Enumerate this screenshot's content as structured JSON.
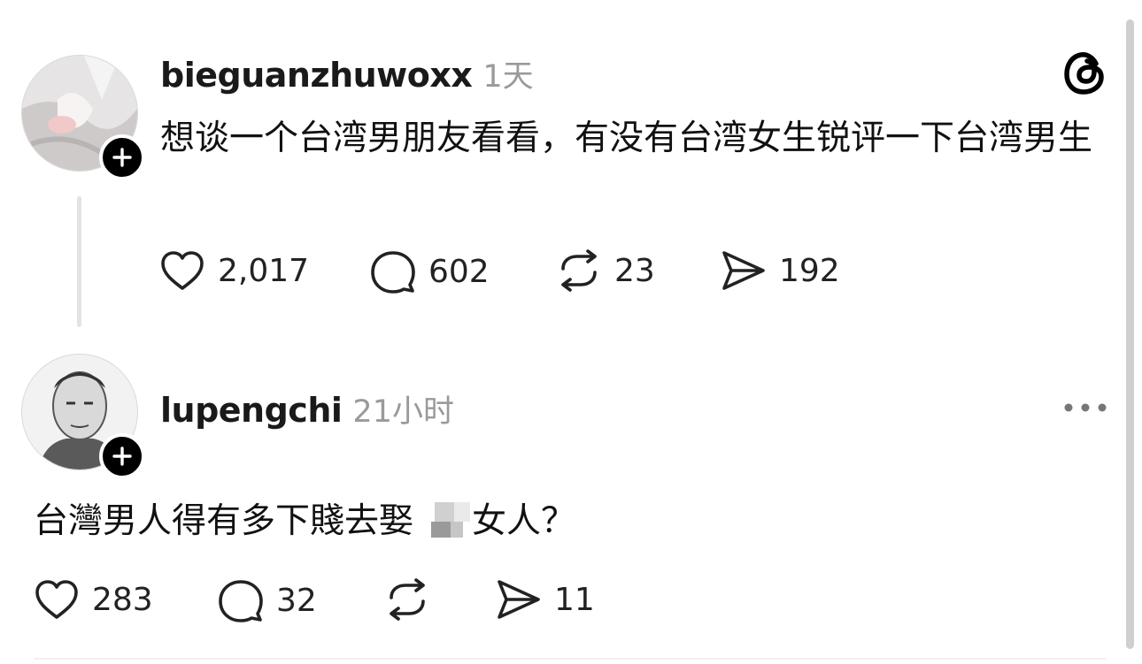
{
  "post": {
    "username": "bieguanzhuwoxx",
    "time": "1天",
    "text": "想谈一个台湾男朋友看看，有没有台湾女生锐评一下台湾男生",
    "likes": "2,017",
    "comments": "602",
    "reposts": "23",
    "shares": "192"
  },
  "reply": {
    "username": "lupengchi",
    "time": "21小时",
    "text_before": "台灣男人得有多下賤去娶",
    "text_after": "女人？",
    "likes": "283",
    "comments": "32",
    "shares": "11"
  },
  "icons": {
    "app_logo": "threads-logo-icon",
    "more": "more-horizontal-icon",
    "like": "heart-icon",
    "comment": "comment-bubble-icon",
    "repost": "repost-icon",
    "share": "send-icon",
    "follow": "plus-icon"
  },
  "colors": {
    "text": "#111111",
    "muted": "#9a9a9a",
    "background": "#ffffff",
    "follow_badge": "#000000"
  }
}
